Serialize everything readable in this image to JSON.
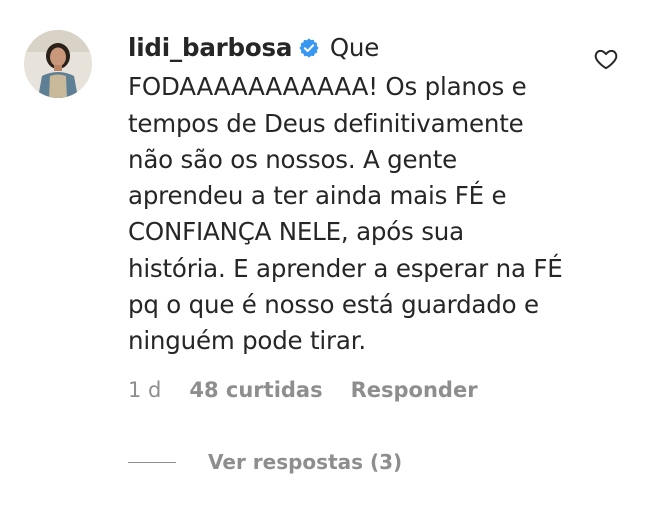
{
  "comment": {
    "username": "lidi_barbosa",
    "text": "Que FODAAAAAAAAAAA! Os planos e tempos de Deus definitivamente não são os nossos. A gente aprendeu a ter ainda mais FÉ e CONFIANÇA NELE, após sua história. E aprender a esperar na FÉ pq o que é nosso está guardado e ninguém pode tirar.",
    "time": "1 d",
    "likes": "48 curtidas",
    "reply_label": "Responder",
    "view_replies": "Ver respostas (3)"
  },
  "icons": {
    "verified": "verified-badge-icon",
    "like": "heart-icon"
  },
  "colors": {
    "text": "#262626",
    "secondary": "#8e8e8e",
    "verified": "#3897f0"
  }
}
